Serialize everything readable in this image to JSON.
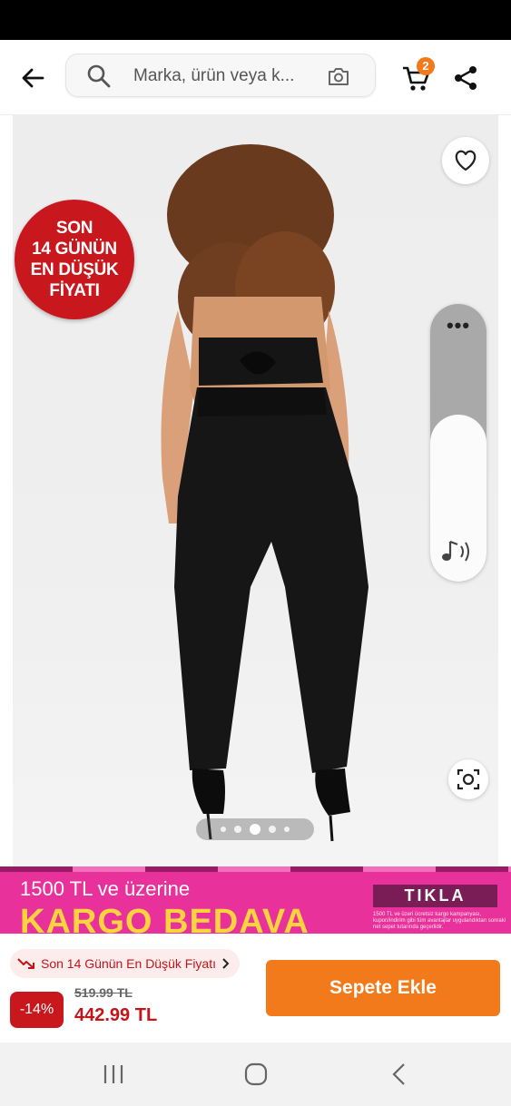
{
  "search": {
    "placeholder": "Marka, ürün veya k..."
  },
  "header": {
    "cart_count": "2"
  },
  "promo_badge": {
    "lines": [
      "SON",
      "14 GÜNÜN",
      "EN DÜŞÜK",
      "FİYATI"
    ]
  },
  "gallery": {
    "total_images": 5,
    "active_index": 2
  },
  "promo_banner": {
    "line1": "1500 TL ve üzerine",
    "line2": "KARGO BEDAVA",
    "cta": "TIKLA",
    "fine_print": "1500 TL ve üzeri ücretsiz kargo kampanyası, kupon/indirim gibi tüm avantajlar uygulandıktan sonraki net sepet tutarında geçerlidir."
  },
  "price": {
    "lowest_label": "Son 14 Günün En Düşük Fiyatı",
    "discount": "-14%",
    "old": "519.99 TL",
    "new": "442.99 TL"
  },
  "actions": {
    "add_to_cart": "Sepete Ekle"
  },
  "colors": {
    "brand_orange": "#f27a1a",
    "discount_red": "#c8171d",
    "promo_pink": "#e8319a",
    "promo_yellow": "#ffd23f"
  }
}
